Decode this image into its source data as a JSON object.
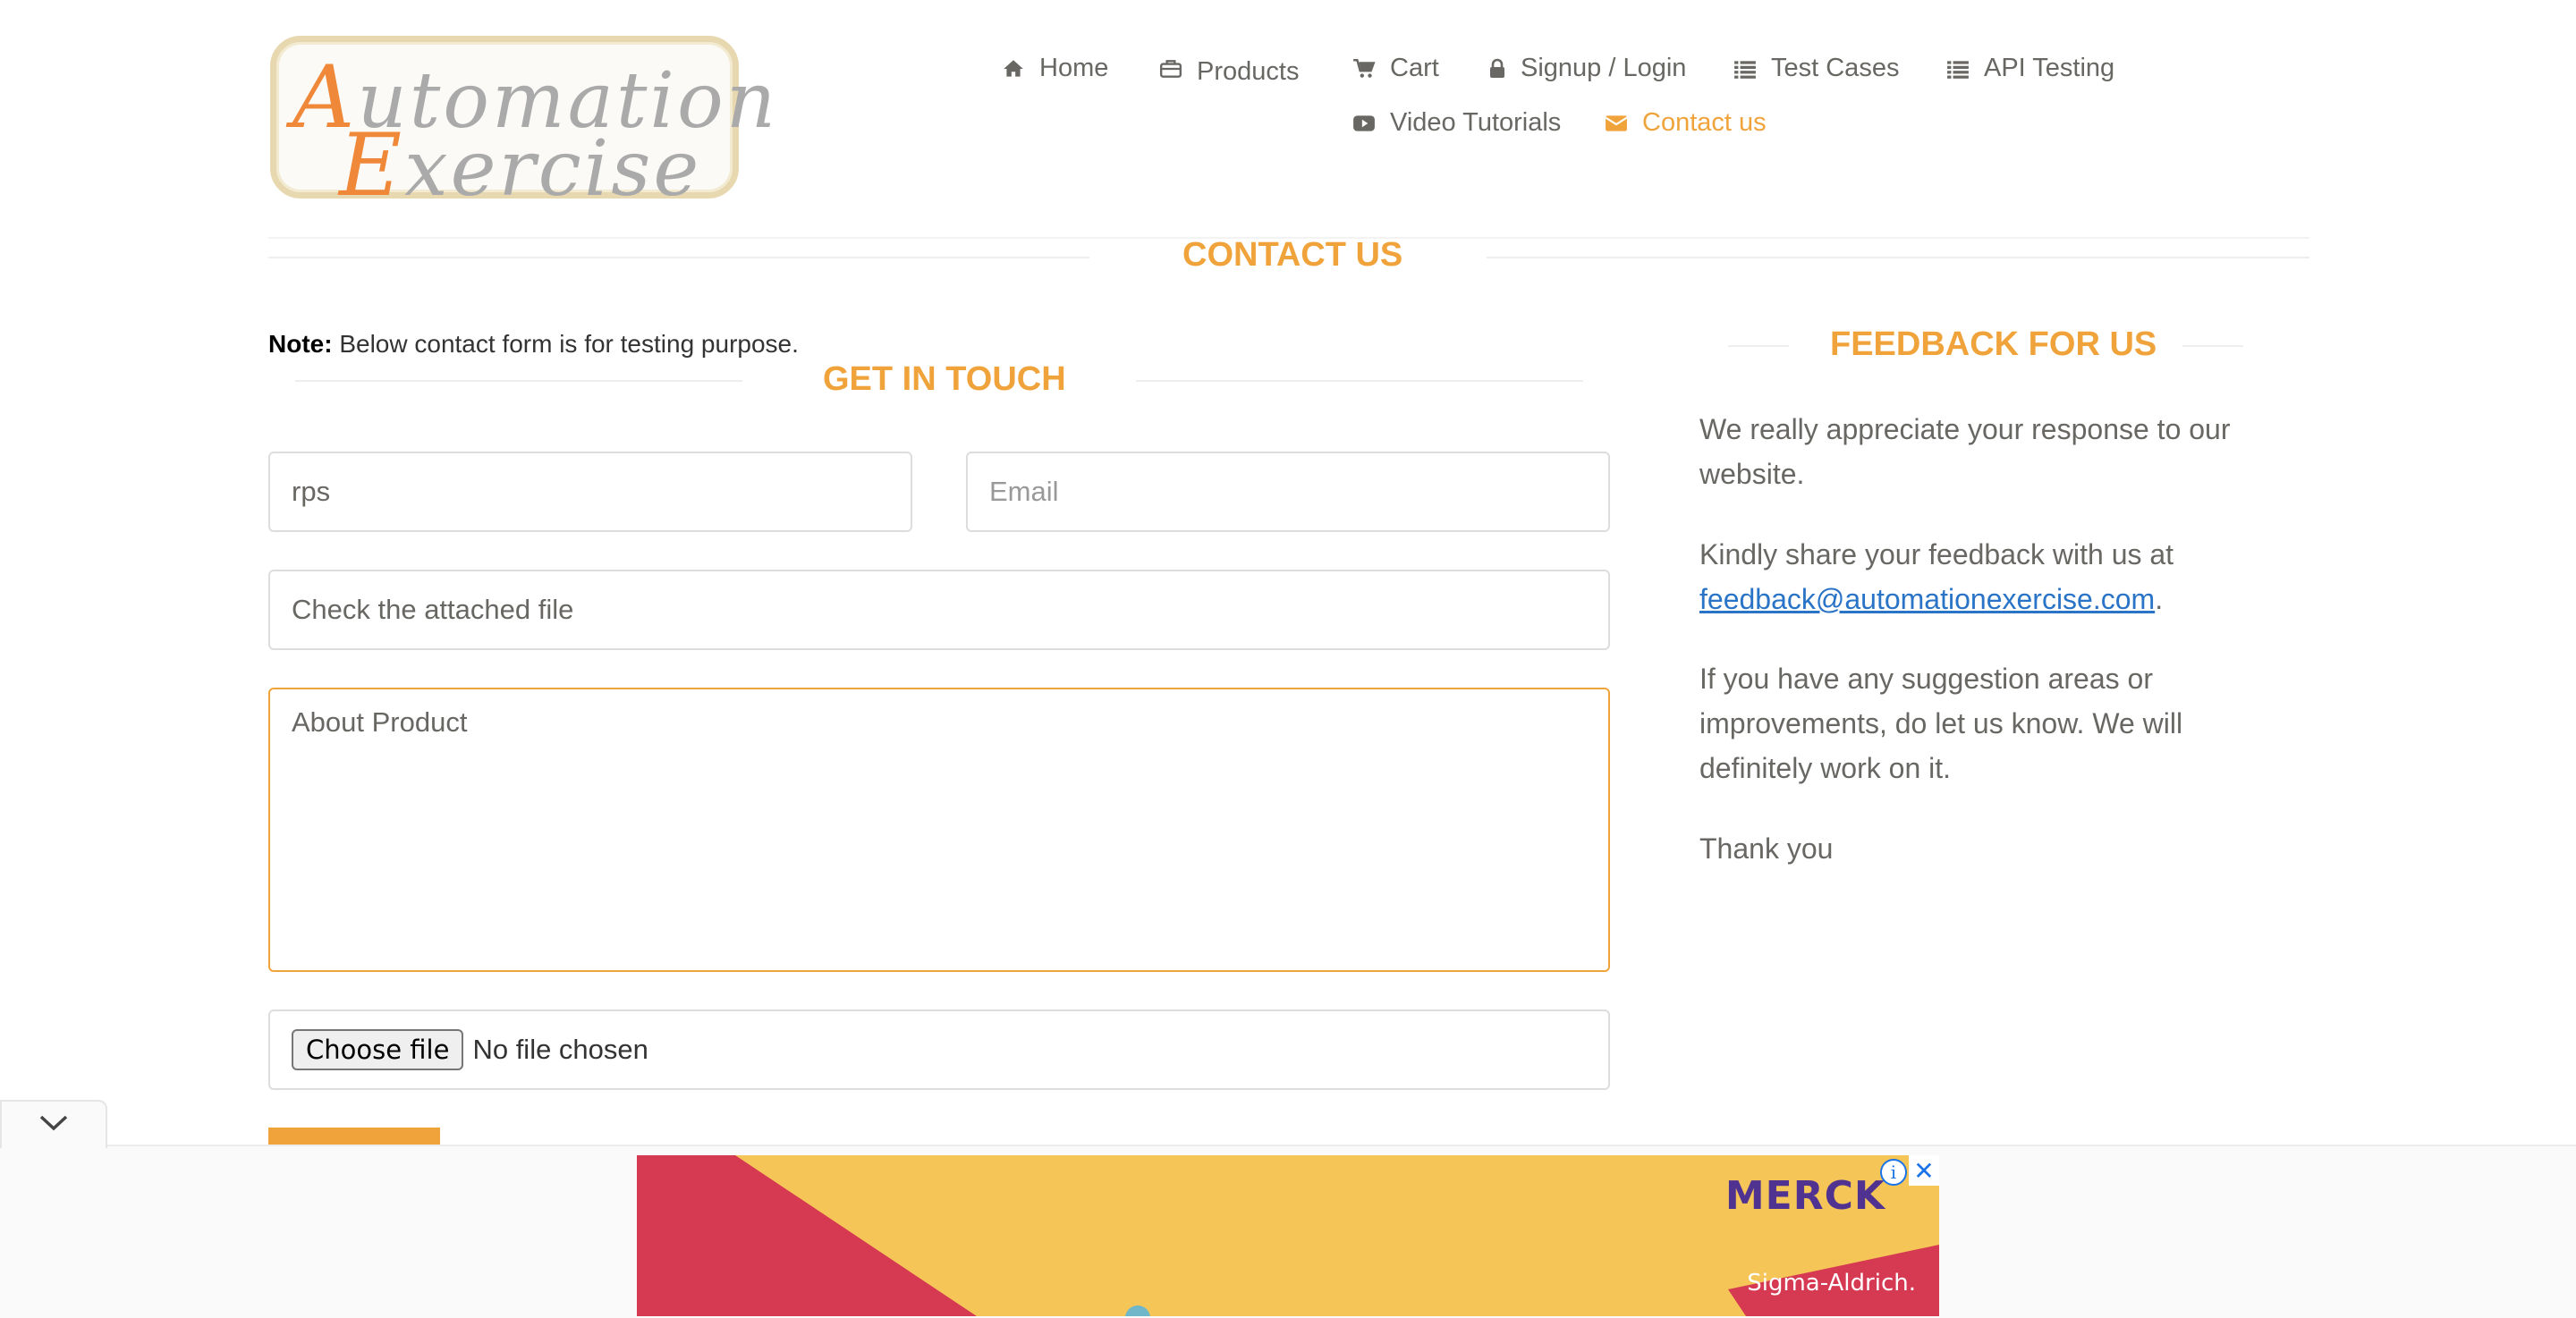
{
  "logo": {
    "line1_cap": "A",
    "line1_rest": "utomation",
    "line2_cap": "E",
    "line2_rest": "xercise"
  },
  "nav": {
    "items": [
      {
        "label": "Home",
        "icon": "home-icon"
      },
      {
        "label": "Products",
        "icon": "briefcase-icon"
      },
      {
        "label": "Cart",
        "icon": "cart-icon"
      },
      {
        "label": "Signup / Login",
        "icon": "lock-icon"
      },
      {
        "label": "Test Cases",
        "icon": "list-icon"
      },
      {
        "label": "API Testing",
        "icon": "list-icon"
      },
      {
        "label": "Video Tutorials",
        "icon": "youtube-icon"
      },
      {
        "label": "Contact us",
        "icon": "envelope-icon",
        "active": true
      }
    ]
  },
  "page": {
    "title": "Contact Us"
  },
  "form": {
    "note_bold": "Note:",
    "note_text": " Below contact form is for testing purpose.",
    "heading": "Get In Touch",
    "name_value": "rps",
    "email_placeholder": "Email",
    "subject_value": "Check the attached file",
    "message_value": "About Product",
    "file_button": "Choose file",
    "file_status": "No file chosen"
  },
  "feedback": {
    "heading": "Feedback For Us",
    "p1_line1": "We really appreciate your response to our",
    "p1_line2": "website.",
    "p2_line1": "Kindly share your feedback with us at",
    "email": "feedback@automationexercise.com",
    "p2_after": ".",
    "p3_line1": "If you have any suggestion areas or",
    "p3_line2": "improvements, do let us know. We will",
    "p3_line3": "definitely work on it.",
    "thanks": "Thank you"
  },
  "ad": {
    "brand": "MERCK",
    "sub_brand": "Sigma-Aldrich.",
    "info_glyph": "i",
    "close_glyph": "✕"
  },
  "colors": {
    "accent": "#f0a33a",
    "text": "#696763",
    "link": "#2a74c7",
    "ad_yellow": "#f5c558",
    "ad_red": "#d63a52"
  }
}
